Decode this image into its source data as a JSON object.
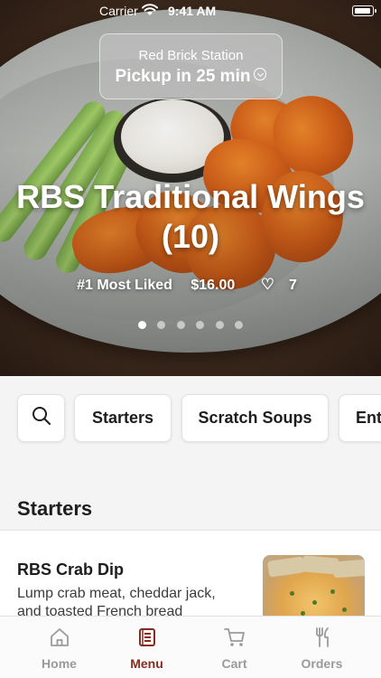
{
  "status_bar": {
    "carrier": "Carrier",
    "time": "9:41 AM"
  },
  "location": {
    "store_name": "Red Brick Station",
    "pickup_label": "Pickup in 25 min"
  },
  "featured_item": {
    "title": "RBS Traditional Wings (10)",
    "badge": "#1 Most Liked",
    "price": "$16.00",
    "likes": "7",
    "carousel_total": 6,
    "carousel_active": 1
  },
  "categories": [
    {
      "label": "Starters"
    },
    {
      "label": "Scratch Soups"
    },
    {
      "label": "Ent"
    }
  ],
  "section": {
    "title": "Starters"
  },
  "menu_items": [
    {
      "name": "RBS Crab Dip",
      "description": "Lump crab meat, cheddar jack, and toasted French bread"
    }
  ],
  "tabs": [
    {
      "label": "Home",
      "icon": "home-icon",
      "active": false
    },
    {
      "label": "Menu",
      "icon": "menu-book-icon",
      "active": true
    },
    {
      "label": "Cart",
      "icon": "cart-icon",
      "active": false
    },
    {
      "label": "Orders",
      "icon": "fork-knife-icon",
      "active": false
    }
  ],
  "colors": {
    "accent": "#8a2a1e",
    "tab_inactive": "#9a9a9a",
    "background": "#f4f4f4"
  }
}
